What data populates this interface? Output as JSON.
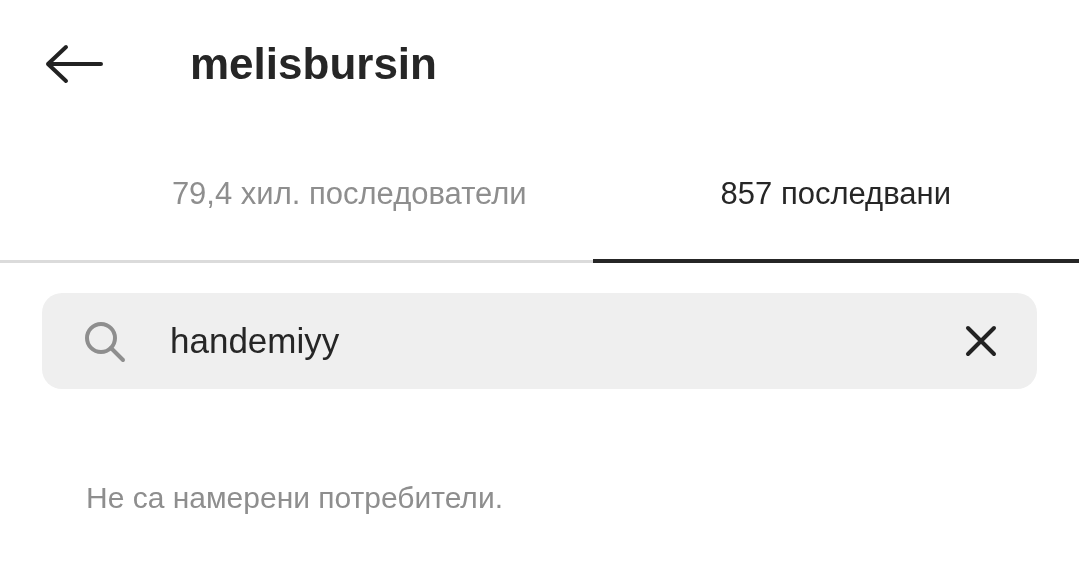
{
  "header": {
    "title": "melisbursin"
  },
  "tabs": [
    {
      "label": "79,4 хил. последователи",
      "selected": false
    },
    {
      "label": "857 последвани",
      "selected": true
    }
  ],
  "search": {
    "value": "handemiyy"
  },
  "message": "Не са намерени потребители."
}
